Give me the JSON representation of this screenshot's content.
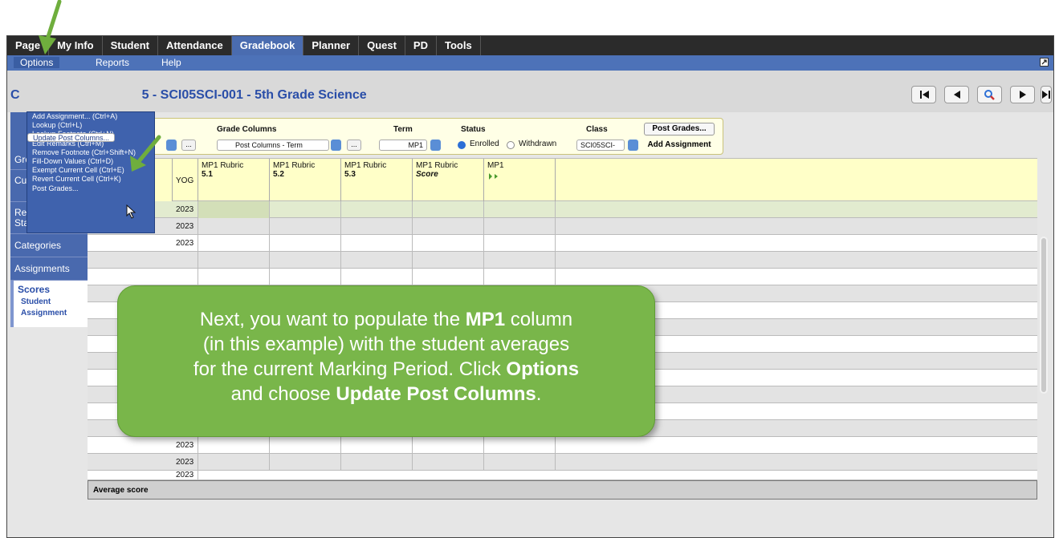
{
  "nav": {
    "tabs": [
      "Page",
      "My Info",
      "Student",
      "Attendance",
      "Gradebook",
      "Planner",
      "Quest",
      "PD",
      "Tools"
    ]
  },
  "menubar": {
    "options": "Options",
    "reports": "Reports",
    "help": "Help"
  },
  "options_menu": {
    "items": [
      "Add Assignment... (Ctrl+A)",
      "Lookup (Ctrl+L)",
      "Lookup Footnote (Ctrl+N)",
      "Edit Remarks (Ctrl+M)",
      "Remove Footnote (Ctrl+Shift+N)",
      "Fill-Down Values (Ctrl+D)",
      "Exempt Current Cell (Ctrl+E)",
      "Revert Current Cell (Ctrl+K)",
      "Update Post Columns...",
      "Post Grades..."
    ]
  },
  "page": {
    "title_prefix": "C",
    "title": "5 - SCI05SCI-001 - 5th Grade Science"
  },
  "sidebar": {
    "items": [
      "Groups",
      "Curriculum Map",
      "Reporting Standards",
      "Categories",
      "Assignments"
    ],
    "scores": {
      "label": "Scores",
      "student": "Student",
      "assignment": "Assignment"
    }
  },
  "controls": {
    "grade_columns_label": "Grade Columns",
    "grade_columns_value": "Post Columns - Term",
    "term_label": "Term",
    "term_value": "MP1",
    "status_label": "Status",
    "enrolled": "Enrolled",
    "withdrawn": "Withdrawn",
    "class_label": "Class",
    "class_value": "SCI05SCI-",
    "post_grades": "Post Grades...",
    "add_assignment": "Add Assignment",
    "dots": "..."
  },
  "grid": {
    "yog_header": "YOG",
    "columns": [
      {
        "title": "MP1 Rubric",
        "sub": "5.1"
      },
      {
        "title": "MP1 Rubric",
        "sub": "5.2"
      },
      {
        "title": "MP1 Rubric",
        "sub": "5.3"
      },
      {
        "title": "MP1 Rubric",
        "sub": "Score"
      },
      {
        "title": "MP1",
        "sub": ""
      }
    ],
    "yog_values": [
      "2023",
      "2023",
      "2023",
      "2023",
      "2023",
      "2023",
      "2023"
    ],
    "average_label": "Average score"
  },
  "callout": {
    "line1_prefix": "Next, you want to populate the ",
    "line1_bold": "MP1",
    "line1_suffix": " column",
    "line2": "(in this example) with the student averages",
    "line3_prefix": "for the current Marking Period. Click ",
    "line3_bold": "Options",
    "line4_prefix": "and choose ",
    "line4_bold": "Update Post Columns",
    "line4_suffix": "."
  },
  "icons": {
    "first": "first-record-icon",
    "prev": "previous-record-icon",
    "search": "search-icon",
    "next": "next-record-icon",
    "last": "last-record-icon",
    "popout": "popout-icon"
  },
  "colors": {
    "callout_green": "#79b64a",
    "arrow_green": "#6fae3d",
    "menu_blue": "#4d72b8",
    "title_blue": "#2a4ea8",
    "header_yellow": "#ffffc8"
  }
}
